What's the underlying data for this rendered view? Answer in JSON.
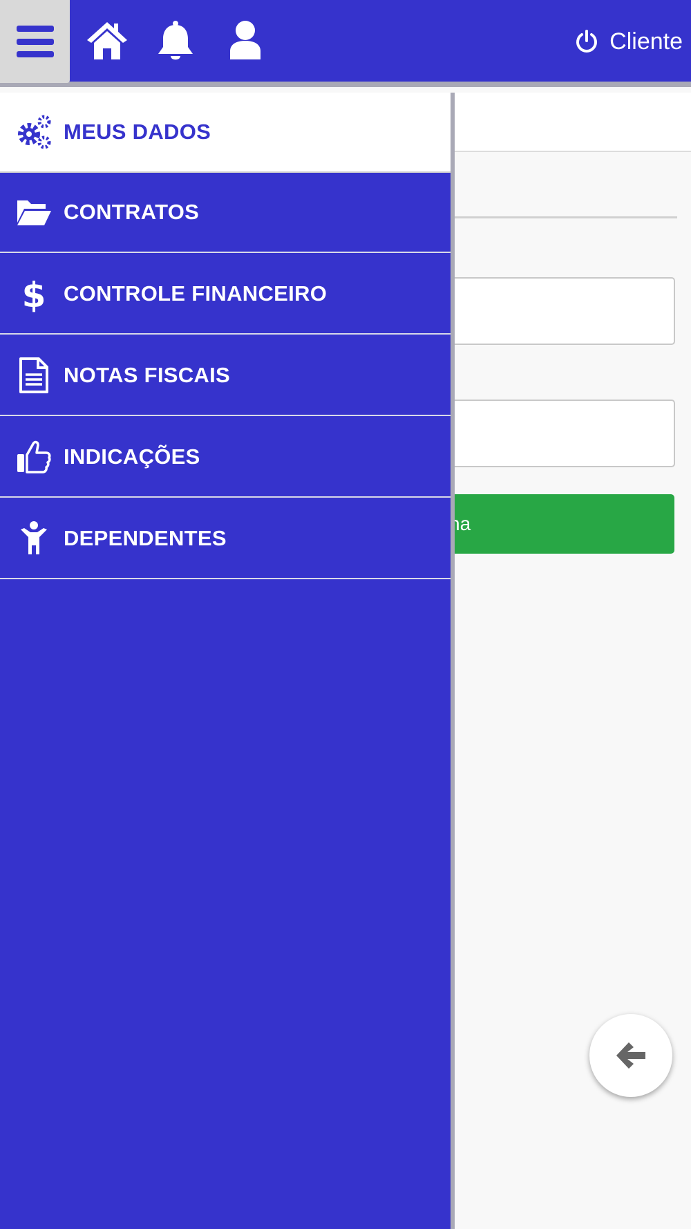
{
  "header": {
    "menu_icon": "hamburger-icon",
    "home_icon": "home-icon",
    "notifications_icon": "bell-icon",
    "profile_icon": "user-icon",
    "logout_label": "Cliente",
    "logout_icon": "power-icon"
  },
  "drawer": {
    "items": [
      {
        "label": "MEUS DADOS",
        "icon": "gears-icon",
        "active": true
      },
      {
        "label": "CONTRATOS",
        "icon": "folder-open-icon",
        "active": false
      },
      {
        "label": "CONTROLE FINANCEIRO",
        "icon": "dollar-icon",
        "active": false
      },
      {
        "label": "NOTAS FISCAIS",
        "icon": "document-icon",
        "active": false
      },
      {
        "label": "INDICAÇÕES",
        "icon": "thumbs-up-icon",
        "active": false
      },
      {
        "label": "DEPENDENTES",
        "icon": "child-icon",
        "active": false
      }
    ]
  },
  "background": {
    "green_button_visible_text": "na",
    "back_button_icon": "arrow-left-icon"
  },
  "colors": {
    "primary": "#3633cc",
    "success": "#28a745",
    "menu_button_bg": "#d9d9d9"
  }
}
